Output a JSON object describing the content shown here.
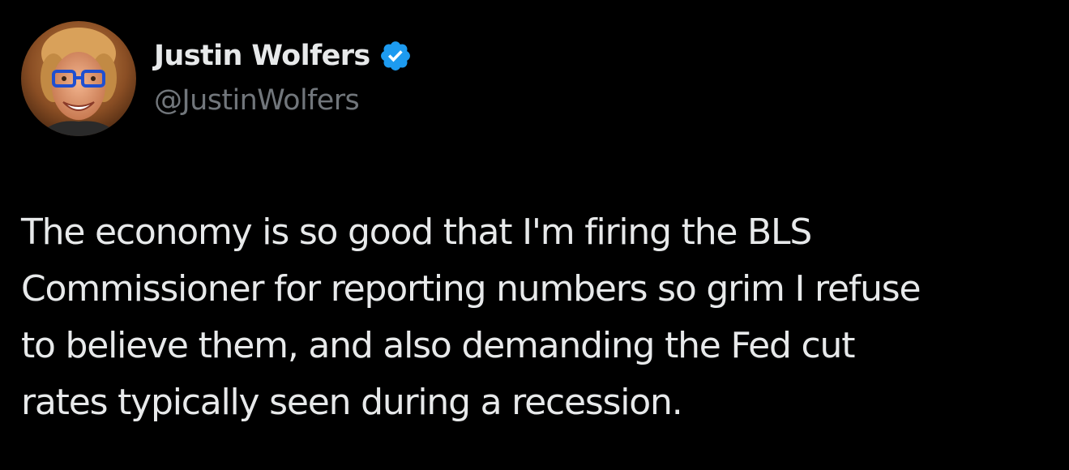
{
  "author": {
    "display_name": "Justin Wolfers",
    "handle": "@JustinWolfers",
    "verified_icon": "verified-badge-icon",
    "avatar_icon": "avatar-photo"
  },
  "tweet": {
    "text": "The economy is so good that I'm firing the BLS\nCommissioner for reporting numbers so grim I refuse\nto believe them, and also demanding the Fed cut\nrates typically seen during a recession."
  },
  "colors": {
    "background": "#000000",
    "primary_text": "#e7e9ea",
    "secondary_text": "#71767b",
    "verified_blue": "#1d9bf0"
  }
}
